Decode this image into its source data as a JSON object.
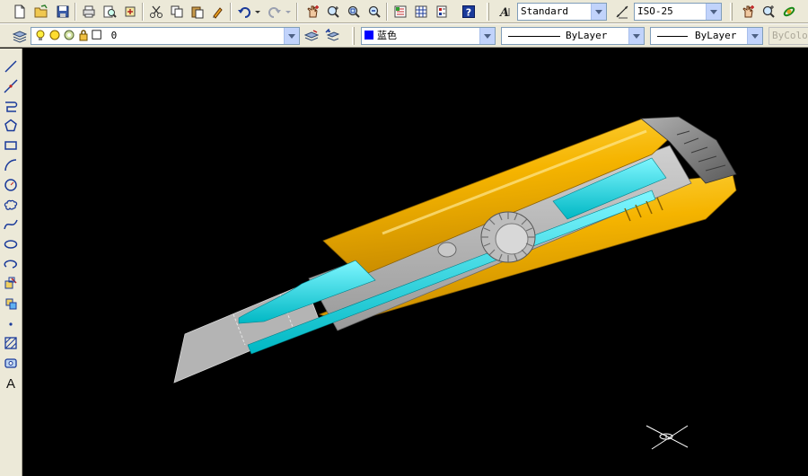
{
  "toolbar_styles": {
    "text_style": "Standard",
    "dim_style": "ISO-25"
  },
  "toolbar_layers": {
    "layer_name": "0",
    "color": "蓝色",
    "color_swatch": "#0000ff",
    "linetype": "ByLayer",
    "lineweight": "ByLayer",
    "plotstyle": "ByColor"
  },
  "draw_tools": [
    "line-icon",
    "construction-line-icon",
    "polyline-icon",
    "polygon-icon",
    "rectangle-icon",
    "arc-icon",
    "circle-icon",
    "revision-cloud-icon",
    "spline-icon",
    "ellipse-icon",
    "ellipse-arc-icon",
    "insert-block-icon",
    "make-block-icon",
    "point-icon",
    "hatch-icon",
    "region-icon",
    "multiline-text-icon"
  ],
  "model": {
    "body_color": "#f5b400",
    "accent_color": "#00e0e8",
    "blade_color": "#b8b8b8",
    "cap_color": "#8a8a8a"
  }
}
